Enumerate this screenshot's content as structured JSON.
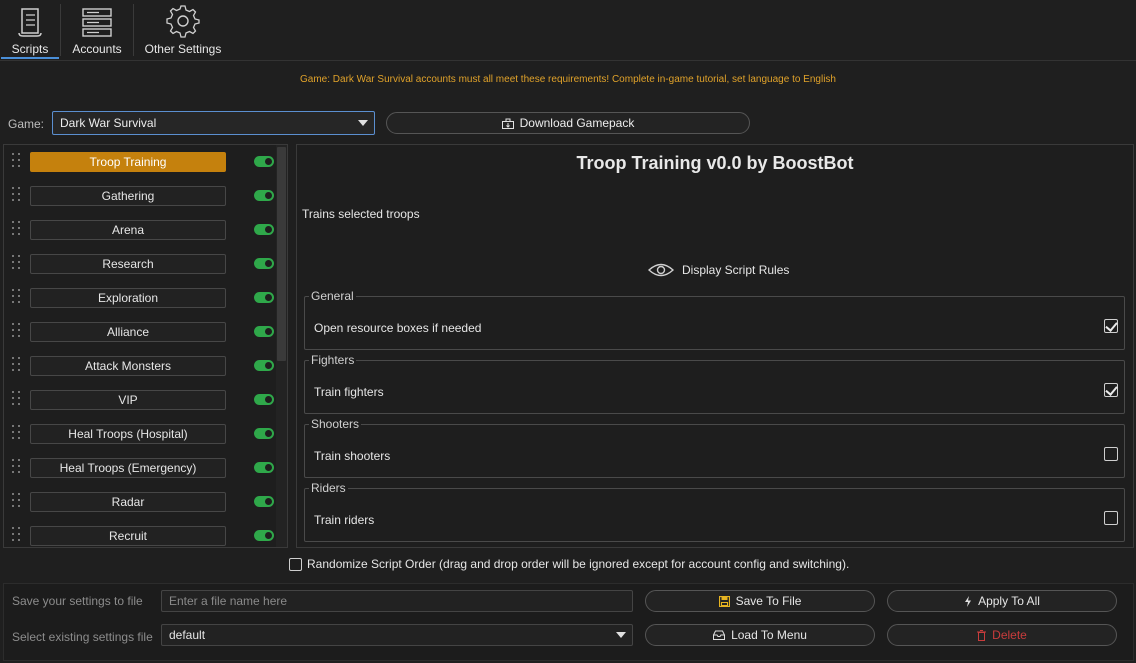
{
  "tabs": [
    {
      "label": "Scripts",
      "icon": "scroll-icon",
      "active": true
    },
    {
      "label": "Accounts",
      "icon": "server-icon",
      "active": false
    },
    {
      "label": "Other Settings",
      "icon": "gear-icon",
      "active": false
    }
  ],
  "notice": "Game: Dark War Survival accounts must all meet these requirements! Complete in-game tutorial, set language to English",
  "game": {
    "label": "Game:",
    "selected": "Dark War Survival",
    "download_label": "Download Gamepack"
  },
  "scripts": [
    {
      "name": "Troop Training",
      "enabled": true,
      "active": true
    },
    {
      "name": "Gathering",
      "enabled": true,
      "active": false
    },
    {
      "name": "Arena",
      "enabled": true,
      "active": false
    },
    {
      "name": "Research",
      "enabled": true,
      "active": false
    },
    {
      "name": "Exploration",
      "enabled": true,
      "active": false
    },
    {
      "name": "Alliance",
      "enabled": true,
      "active": false
    },
    {
      "name": "Attack Monsters",
      "enabled": true,
      "active": false
    },
    {
      "name": "VIP",
      "enabled": true,
      "active": false
    },
    {
      "name": "Heal Troops (Hospital)",
      "enabled": true,
      "active": false
    },
    {
      "name": "Heal Troops (Emergency)",
      "enabled": true,
      "active": false
    },
    {
      "name": "Radar",
      "enabled": true,
      "active": false
    },
    {
      "name": "Recruit",
      "enabled": true,
      "active": false
    }
  ],
  "detail": {
    "title": "Troop Training v0.0 by BoostBot",
    "description": "Trains selected troops",
    "rules_label": "Display Script Rules",
    "groups": [
      {
        "title": "General",
        "item": "Open resource boxes if needed",
        "checked": true
      },
      {
        "title": "Fighters",
        "item": "Train fighters",
        "checked": true
      },
      {
        "title": "Shooters",
        "item": "Train shooters",
        "checked": false
      },
      {
        "title": "Riders",
        "item": "Train riders",
        "checked": false
      }
    ]
  },
  "randomize_label": "Randomize Script Order (drag and drop order will be ignored except for account config and switching).",
  "randomize_checked": false,
  "bottom": {
    "save_label": "Save your settings to file",
    "save_placeholder": "Enter a file name here",
    "select_label": "Select existing settings file",
    "select_value": "default",
    "save_to_file": "Save To File",
    "apply_to_all": "Apply To All",
    "load_to_menu": "Load To Menu",
    "delete": "Delete"
  },
  "colors": {
    "accent": "#c5810d",
    "toggle_on": "#2fa84a",
    "notice": "#e0a22a",
    "danger": "#c93c3c",
    "tab_underline": "#4a8fd8"
  }
}
